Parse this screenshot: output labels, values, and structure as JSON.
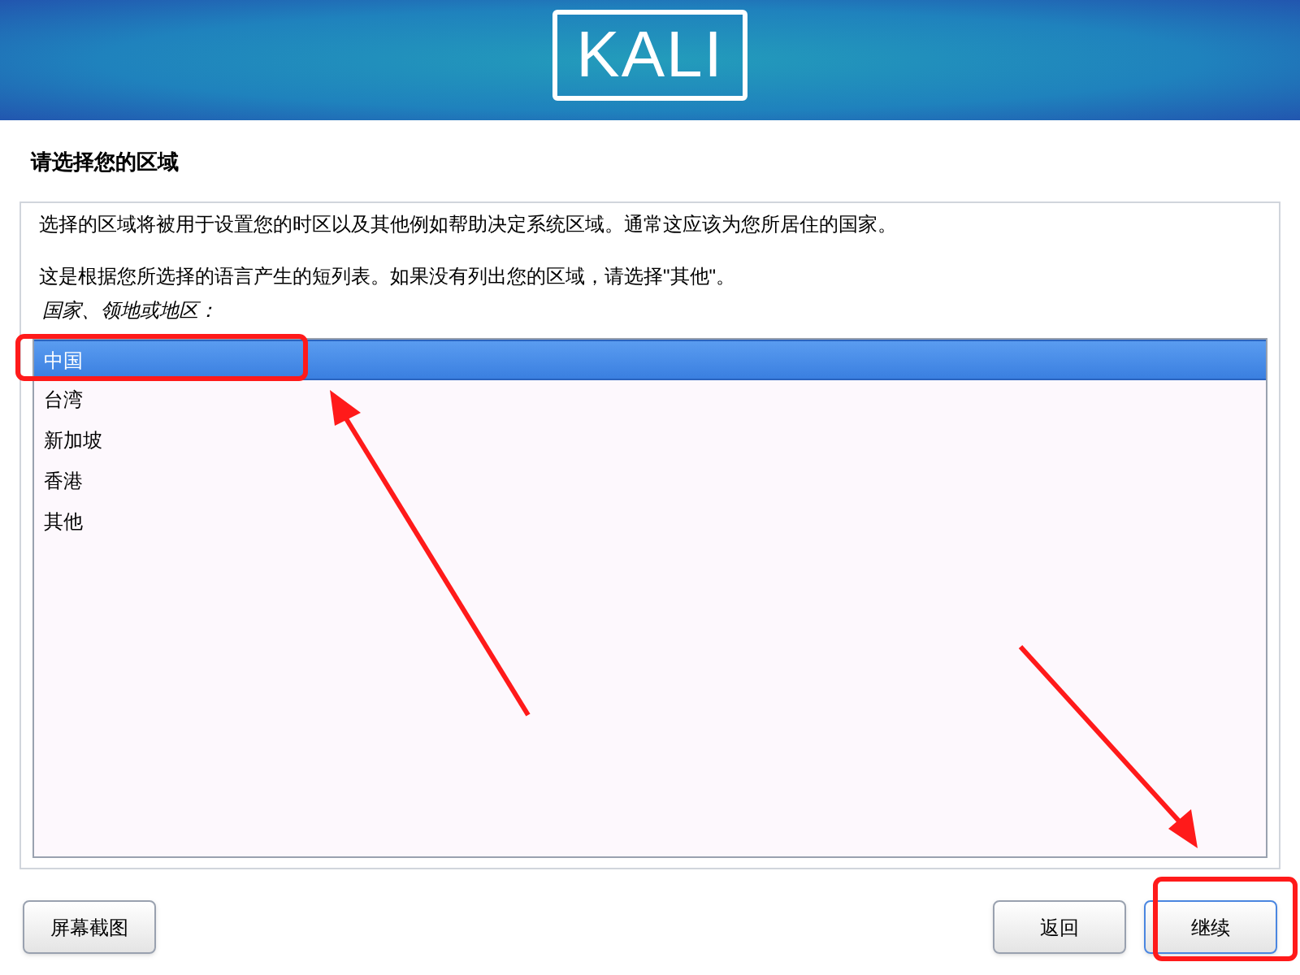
{
  "banner": {
    "logo": "KALI"
  },
  "title": "请选择您的区域",
  "description": [
    "选择的区域将被用于设置您的时区以及其他例如帮助决定系统区域。通常这应该为您所居住的国家。",
    "这是根据您所选择的语言产生的短列表。如果没有列出您的区域，请选择\"其他\"。"
  ],
  "list_label": "国家、领地或地区：",
  "countries": [
    {
      "label": "中国",
      "selected": true
    },
    {
      "label": "台湾",
      "selected": false
    },
    {
      "label": "新加坡",
      "selected": false
    },
    {
      "label": "香港",
      "selected": false
    },
    {
      "label": "其他",
      "selected": false
    }
  ],
  "buttons": [
    {
      "label": "屏幕截图",
      "kind": "left",
      "focused": false
    },
    {
      "label": "返回",
      "kind": "right",
      "focused": false
    },
    {
      "label": "继续",
      "kind": "right",
      "focused": true
    }
  ]
}
